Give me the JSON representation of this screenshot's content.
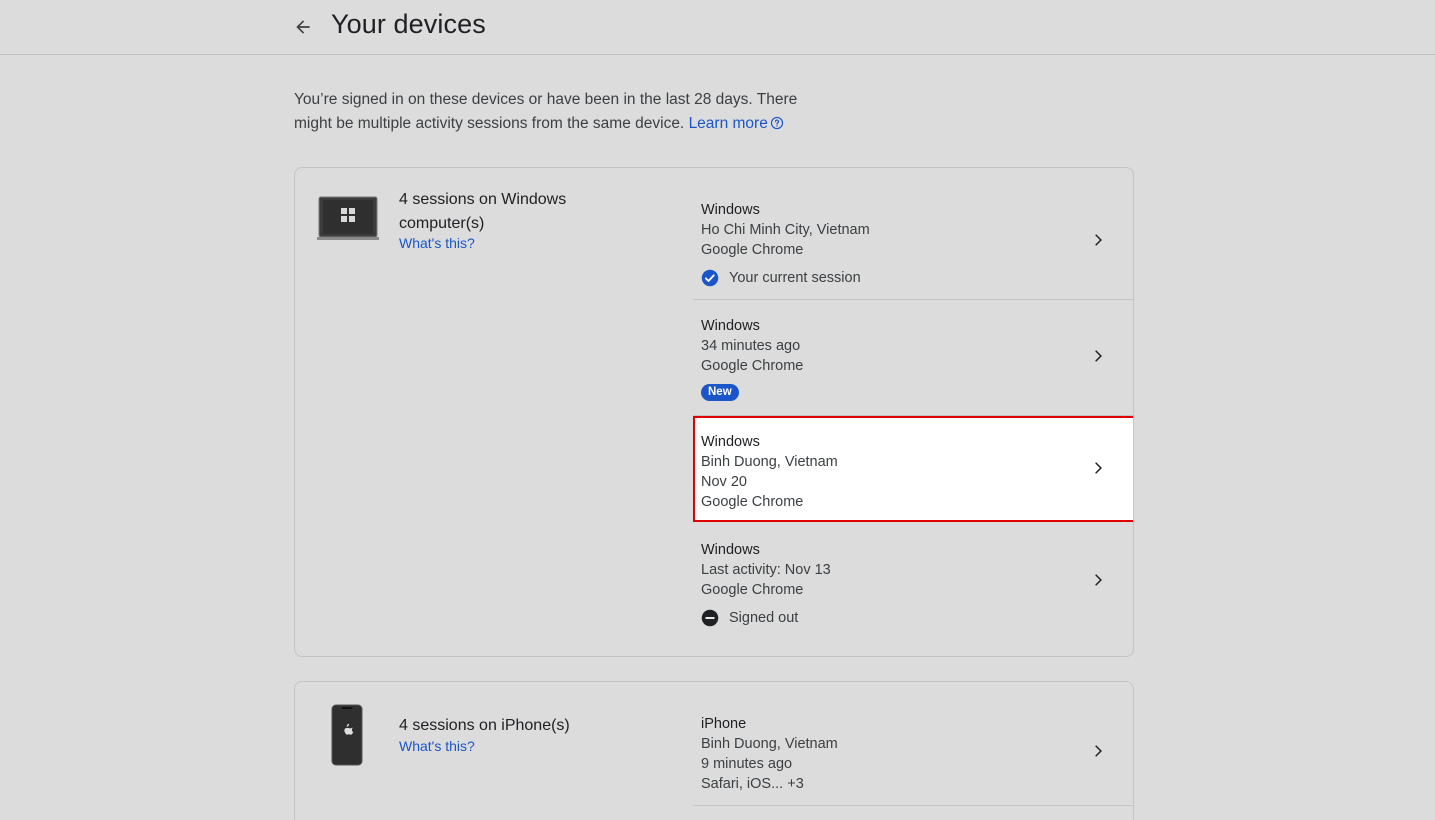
{
  "header": {
    "title": "Your devices"
  },
  "intro": {
    "text": "You’re signed in on these devices or have been in the last 28 days. There might be multiple activity sessions from the same device.",
    "learn_more": "Learn more"
  },
  "groups": [
    {
      "title": "4 sessions on Windows computer(s)",
      "whats_this": "What's this?",
      "icon": "windows-laptop-icon",
      "sessions": [
        {
          "device": "Windows",
          "line2": "Ho Chi Minh City, Vietnam",
          "line3": "Google Chrome",
          "status": "Your current session",
          "status_icon": "check-circle-icon"
        },
        {
          "device": "Windows",
          "line2": "34 minutes ago",
          "line3": "Google Chrome",
          "badge": "New"
        },
        {
          "device": "Windows",
          "line2": "Binh Duong, Vietnam",
          "line3": "Nov 20",
          "line4": "Google Chrome"
        },
        {
          "device": "Windows",
          "line2": "Last activity: Nov 13",
          "line3": "Google Chrome",
          "status": "Signed out",
          "status_icon": "minus-circle-icon"
        }
      ]
    },
    {
      "title": "4 sessions on iPhone(s)",
      "whats_this": "What's this?",
      "icon": "iphone-icon",
      "sessions": [
        {
          "device": "iPhone",
          "line2": "Binh Duong, Vietnam",
          "line3": "9 minutes ago",
          "line4": "Safari, iOS... +3"
        }
      ]
    }
  ],
  "colors": {
    "background": "#dcdcdc",
    "link": "#1a56c8",
    "highlight_border": "#e00000",
    "check": "#1a56c8"
  }
}
